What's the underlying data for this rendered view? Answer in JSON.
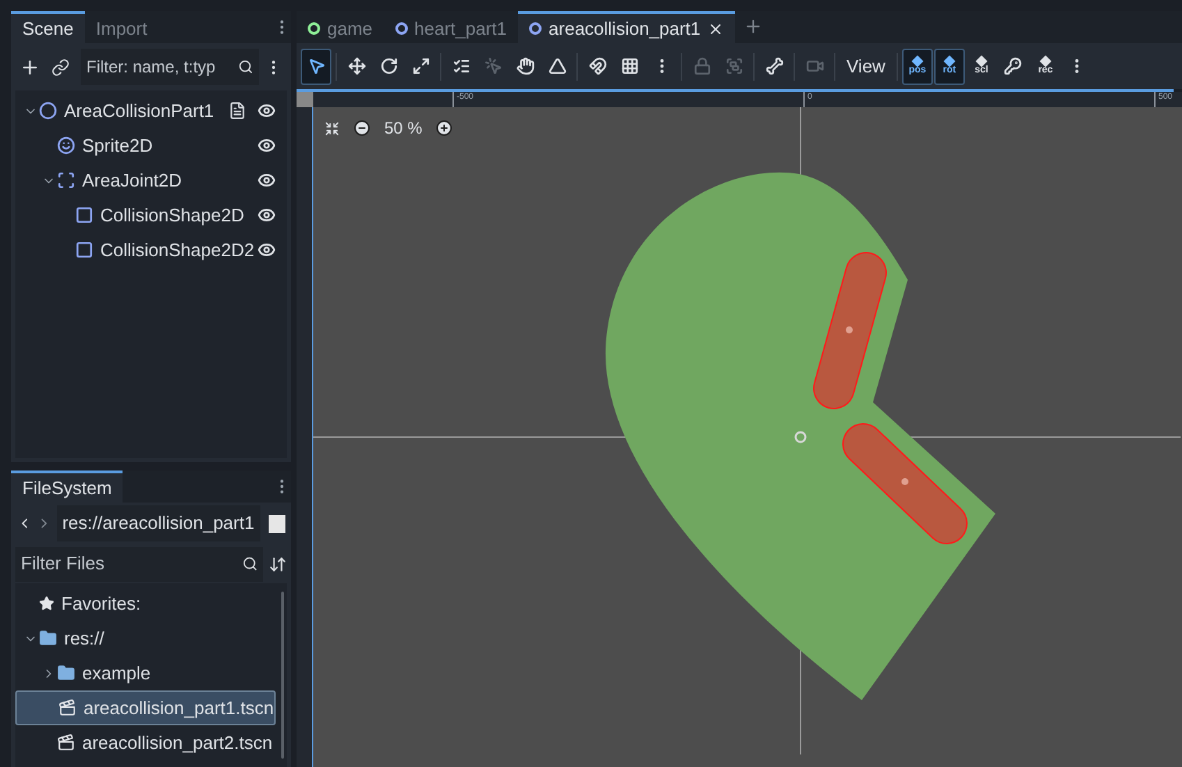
{
  "scene_dock": {
    "tabs": [
      {
        "label": "Scene",
        "selected": true
      },
      {
        "label": "Import",
        "selected": false
      }
    ],
    "filter": {
      "placeholder": "Filter: name, t:typ"
    },
    "tree": [
      {
        "name": "AreaCollisionPart1",
        "kind": "area",
        "expanded": true,
        "has_script": true,
        "visible": true,
        "selected": false,
        "children": [
          {
            "name": "Sprite2D",
            "kind": "sprite",
            "has_script": false,
            "visible": true,
            "selected": false
          },
          {
            "name": "AreaJoint2D",
            "kind": "joint",
            "expanded": true,
            "has_script": false,
            "visible": true,
            "selected": false,
            "children": [
              {
                "name": "CollisionShape2D",
                "kind": "shape",
                "has_script": false,
                "visible": true,
                "selected": false
              },
              {
                "name": "CollisionShape2D2",
                "kind": "shape",
                "has_script": false,
                "visible": true,
                "selected": false
              }
            ]
          }
        ]
      }
    ]
  },
  "filesystem": {
    "tabs": [
      {
        "label": "FileSystem",
        "selected": true
      }
    ],
    "path": "res://areacollision_part1",
    "filter": {
      "placeholder": "Filter Files"
    },
    "tree": [
      {
        "name": "Favorites:",
        "kind": "favorites",
        "selected": false
      },
      {
        "name": "res://",
        "kind": "folder",
        "expanded": true,
        "selected": false,
        "children": [
          {
            "name": "example",
            "kind": "folder",
            "expanded": false,
            "selected": false
          },
          {
            "name": "areacollision_part1.tscn",
            "kind": "scene",
            "selected": true
          },
          {
            "name": "areacollision_part2.tscn",
            "kind": "scene",
            "selected": false
          }
        ]
      }
    ]
  },
  "editor_tabs": [
    {
      "label": "game",
      "color": "#8eef97",
      "selected": false
    },
    {
      "label": "heart_part1",
      "color": "#8da5f3",
      "selected": false
    },
    {
      "label": "areacollision_part1",
      "color": "#8da5f3",
      "selected": true
    }
  ],
  "toolbar": [
    {
      "kind": "select",
      "selected": true,
      "disabled": false
    },
    {
      "kind": "sep"
    },
    {
      "kind": "move",
      "selected": false,
      "disabled": false
    },
    {
      "kind": "rotate",
      "selected": false,
      "disabled": false
    },
    {
      "kind": "scale",
      "selected": false,
      "disabled": false
    },
    {
      "kind": "sep"
    },
    {
      "kind": "list",
      "selected": false,
      "disabled": false
    },
    {
      "kind": "pivot",
      "selected": false,
      "disabled": true
    },
    {
      "kind": "pan",
      "selected": false,
      "disabled": false
    },
    {
      "kind": "ruler",
      "selected": false,
      "disabled": false
    },
    {
      "kind": "sep"
    },
    {
      "kind": "snap",
      "selected": false,
      "disabled": false
    },
    {
      "kind": "grid",
      "selected": false,
      "disabled": false
    },
    {
      "kind": "more",
      "selected": false,
      "disabled": false
    },
    {
      "kind": "sep"
    },
    {
      "kind": "lock",
      "selected": false,
      "disabled": true
    },
    {
      "kind": "group",
      "selected": false,
      "disabled": true
    },
    {
      "kind": "sep"
    },
    {
      "kind": "bone",
      "selected": false,
      "disabled": false
    },
    {
      "kind": "sep"
    },
    {
      "kind": "camera",
      "selected": false,
      "disabled": true
    },
    {
      "kind": "sep"
    },
    {
      "kind": "text",
      "label": "View",
      "selected": false,
      "disabled": false
    },
    {
      "kind": "sep"
    },
    {
      "kind": "key",
      "label": "pos",
      "selected": true,
      "disabled": false
    },
    {
      "kind": "key",
      "label": "rot",
      "selected": true,
      "disabled": false
    },
    {
      "kind": "key",
      "label": "scl",
      "selected": false,
      "disabled": false
    },
    {
      "kind": "keyicon",
      "selected": false,
      "disabled": false
    },
    {
      "kind": "key",
      "label": "rec",
      "selected": false,
      "disabled": false
    },
    {
      "kind": "more",
      "selected": false,
      "disabled": false
    }
  ],
  "ruler": {
    "labels": [
      "-500",
      "0",
      "500"
    ]
  },
  "zoom": {
    "value": "50 %"
  }
}
